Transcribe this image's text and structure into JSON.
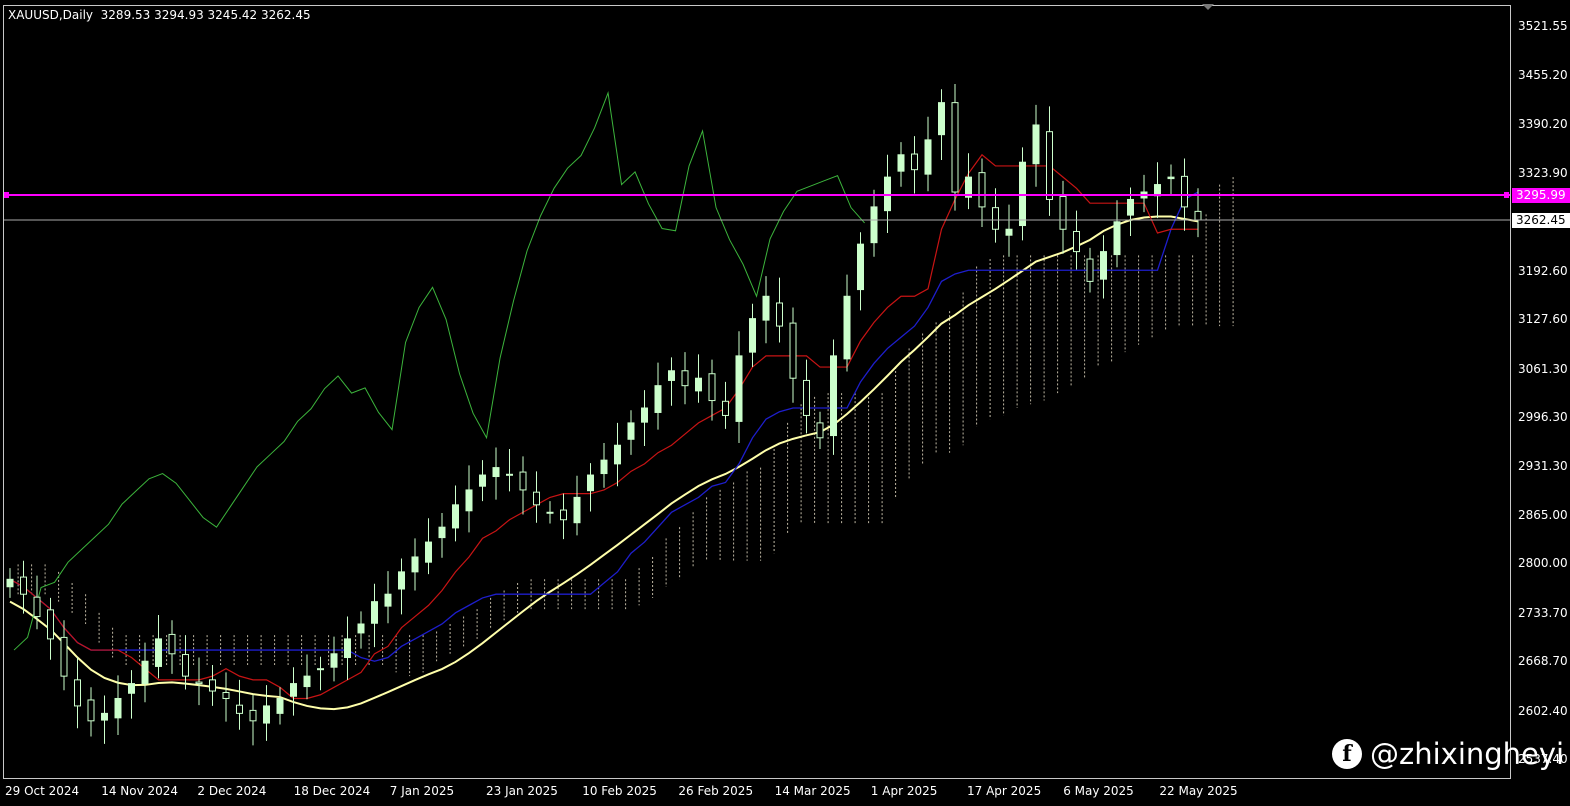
{
  "header": {
    "symbol_line": "XAUUSD,Daily  3289.53 3294.93 3245.42 3262.45"
  },
  "price_axis": {
    "labels": [
      "3521.55",
      "3455.20",
      "3390.20",
      "3323.90",
      "3192.60",
      "3127.60",
      "3061.30",
      "2996.30",
      "2931.30",
      "2865.00",
      "2800.00",
      "2733.70",
      "2668.70",
      "2602.40",
      "2537.40"
    ]
  },
  "badges": {
    "magenta_value": "3295.99",
    "current_value": "3262.45"
  },
  "time_axis": {
    "labels": [
      "29 Oct 2024",
      "14 Nov 2024",
      "2 Dec 2024",
      "18 Dec 2024",
      "7 Jan 2025",
      "23 Jan 2025",
      "10 Feb 2025",
      "26 Feb 2025",
      "14 Mar 2025",
      "1 Apr 2025",
      "17 Apr 2025",
      "6 May 2025",
      "22 May 2025"
    ]
  },
  "watermark": {
    "icon": "facebook-icon",
    "text": "@zhixingheyi"
  },
  "colors": {
    "background": "#000000",
    "bull_candle": "#ccffcc",
    "bear_candle": "#000000",
    "chikou": "#3cb43c",
    "tenkan": "#c81414",
    "kijun": "#1e1ecc",
    "ma": "#ffffaa",
    "magenta_line": "#ff00ff",
    "cloud": "#e0d8c0"
  },
  "chart_data": {
    "type": "candlestick",
    "symbol": "XAUUSD",
    "timeframe": "Daily",
    "ohlc_last": {
      "open": 3289.53,
      "high": 3294.93,
      "low": 3245.42,
      "close": 3262.45
    },
    "horizontal_lines": [
      3295.99,
      3262.45
    ],
    "ylim": [
      2537.4,
      3521.55
    ],
    "anchors": {
      "dates": [
        "29 Oct 2024",
        "14 Nov 2024",
        "2 Dec 2024",
        "18 Dec 2024",
        "7 Jan 2025",
        "23 Jan 2025",
        "10 Feb 2025",
        "26 Feb 2025",
        "14 Mar 2025",
        "1 Apr 2025",
        "17 Apr 2025",
        "6 May 2025",
        "22 May 2025"
      ],
      "close": [
        2770,
        2600,
        2650,
        2600,
        2665,
        2770,
        2890,
        2920,
        2990,
        3120,
        3300,
        3320,
        3300
      ]
    },
    "last_close_series": [
      3280,
      3300,
      3262.45
    ],
    "series": [
      {
        "key": "close_path",
        "points": [
          2780,
          2760,
          2730,
          2700,
          2650,
          2610,
          2590,
          2600,
          2620,
          2640,
          2670,
          2700,
          2680,
          2650,
          2640,
          2630,
          2620,
          2600,
          2590,
          2610,
          2620,
          2640,
          2650,
          2660,
          2680,
          2700,
          2720,
          2750,
          2760,
          2790,
          2810,
          2830,
          2850,
          2880,
          2900,
          2920,
          2930,
          2920,
          2900,
          2880,
          2870,
          2860,
          2890,
          2920,
          2940,
          2960,
          2990,
          3010,
          3040,
          3060,
          3040,
          3050,
          3020,
          3000,
          3080,
          3130,
          3160,
          3120,
          3050,
          3000,
          2970,
          3080,
          3160,
          3230,
          3280,
          3320,
          3350,
          3330,
          3370,
          3420,
          3300,
          3320,
          3280,
          3250,
          3250,
          3340,
          3390,
          3290,
          3250,
          3220,
          3180,
          3220,
          3260,
          3290,
          3300,
          3310,
          3320,
          3280,
          3262.45
        ]
      }
    ]
  }
}
